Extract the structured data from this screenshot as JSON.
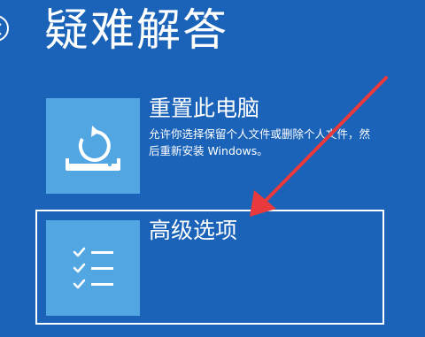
{
  "page": {
    "title": "疑难解答"
  },
  "options": [
    {
      "label": "重置此电脑",
      "description": "允许你选择保留个人文件或删除个人文件，然后重新安装 Windows。",
      "icon": "reset-pc-icon"
    },
    {
      "label": "高级选项",
      "icon": "checklist-icon"
    }
  ],
  "annotation": {
    "arrow_color": "#e8393c"
  },
  "colors": {
    "background": "#1a63b8",
    "tile": "#52a6e2",
    "text": "#ffffff"
  }
}
